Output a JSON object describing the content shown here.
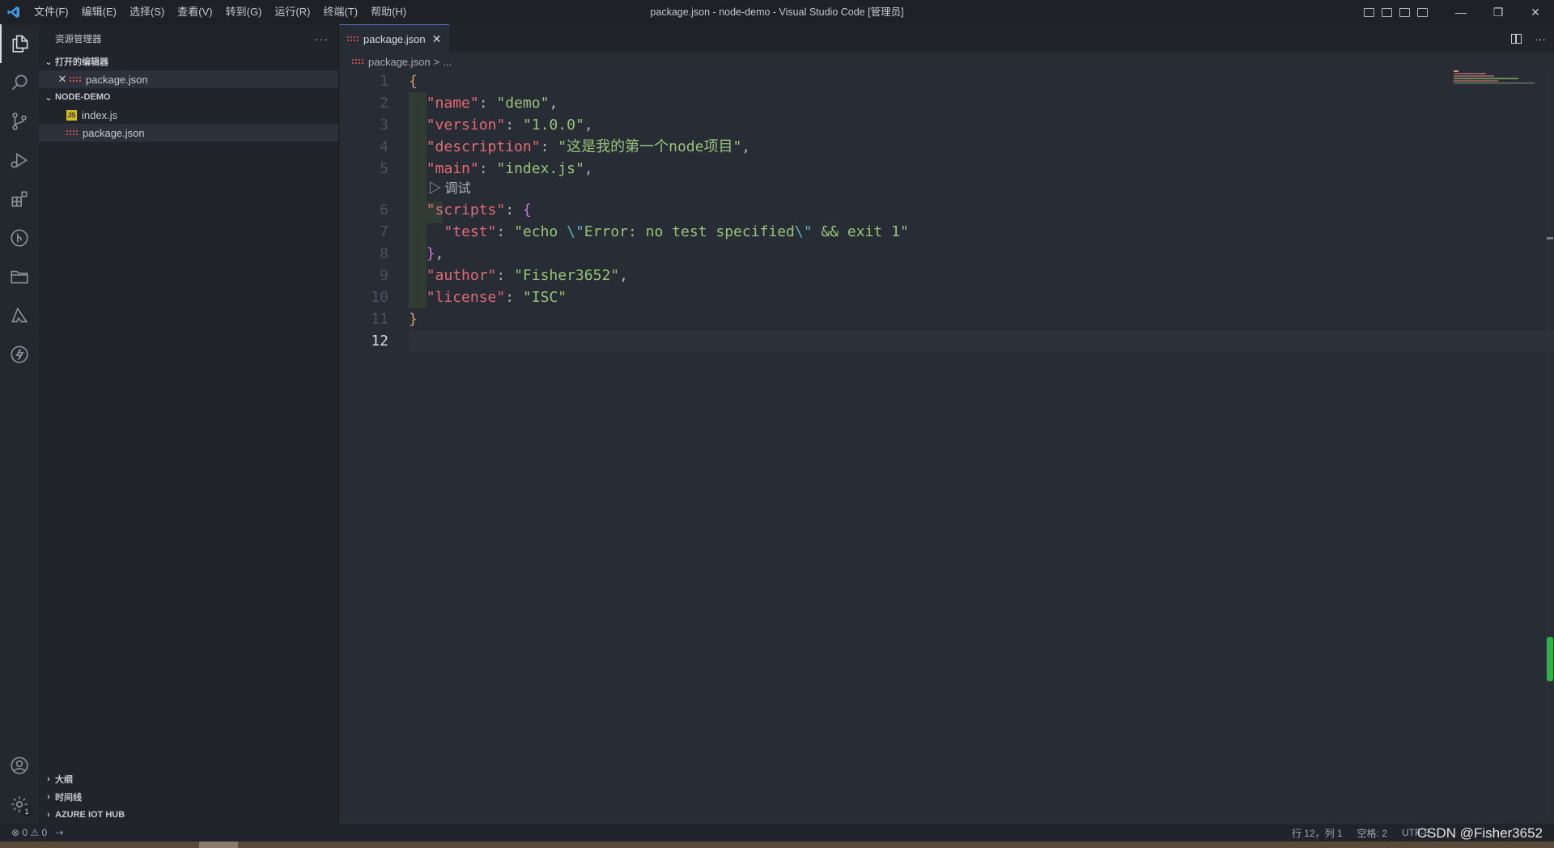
{
  "titlebar": {
    "menu": [
      "文件(F)",
      "编辑(E)",
      "选择(S)",
      "查看(V)",
      "转到(G)",
      "运行(R)",
      "终端(T)",
      "帮助(H)"
    ],
    "window_title": "package.json - node-demo - Visual Studio Code [管理员]",
    "minimize": "—",
    "restore": "❐",
    "close": "✕"
  },
  "activitybar": {
    "icons": [
      "explorer-icon",
      "search-icon",
      "source-control-icon",
      "run-debug-icon",
      "extensions-icon",
      "git-graph-icon",
      "folder-icon",
      "azure-icon",
      "lightning-icon"
    ],
    "settings_badge": "1"
  },
  "sidebar": {
    "title": "资源管理器",
    "more": "···",
    "open_editors": {
      "label": "打开的编辑器",
      "items": [
        {
          "name": "package.json",
          "close": "✕"
        }
      ]
    },
    "project": {
      "label": "NODE-DEMO",
      "files": [
        {
          "name": "index.js",
          "icon": "JS"
        },
        {
          "name": "package.json",
          "icon": "json-icon"
        }
      ]
    },
    "bottom_sections": [
      "大纲",
      "时间线",
      "AZURE IOT HUB"
    ]
  },
  "editor": {
    "tab": {
      "label": "package.json",
      "close": "✕"
    },
    "more": "···",
    "breadcrumb": {
      "file": "package.json",
      "sep": ">",
      "rest": "..."
    },
    "codelens": "调试",
    "line_numbers": [
      "1",
      "2",
      "3",
      "4",
      "5",
      "6",
      "7",
      "8",
      "9",
      "10",
      "11",
      "12"
    ],
    "code": {
      "l1": "{",
      "l2_key": "\"name\"",
      "l2_val": "\"demo\"",
      "l3_key": "\"version\"",
      "l3_val": "\"1.0.0\"",
      "l4_key": "\"description\"",
      "l4_val": "\"这是我的第一个node项目\"",
      "l5_key": "\"main\"",
      "l5_val": "\"index.js\"",
      "l6_key": "\"scripts\"",
      "l6_brace": "{",
      "l7_key": "\"test\"",
      "l7_val_a": "\"echo ",
      "l7_esc1": "\\\"",
      "l7_val_b": "Error: no test specified",
      "l7_esc2": "\\\"",
      "l7_val_c": " && exit 1\"",
      "l8": "}",
      "l9_key": "\"author\"",
      "l9_val": "\"Fisher3652\"",
      "l10_key": "\"license\"",
      "l10_val": "\"ISC\"",
      "l11": "}"
    }
  },
  "statusbar": {
    "errors": "0",
    "warnings": "0",
    "position": "行 12，列 1",
    "spaces": "空格: 2",
    "encoding": "UTF-8"
  },
  "watermark": "CSDN @Fisher3652"
}
